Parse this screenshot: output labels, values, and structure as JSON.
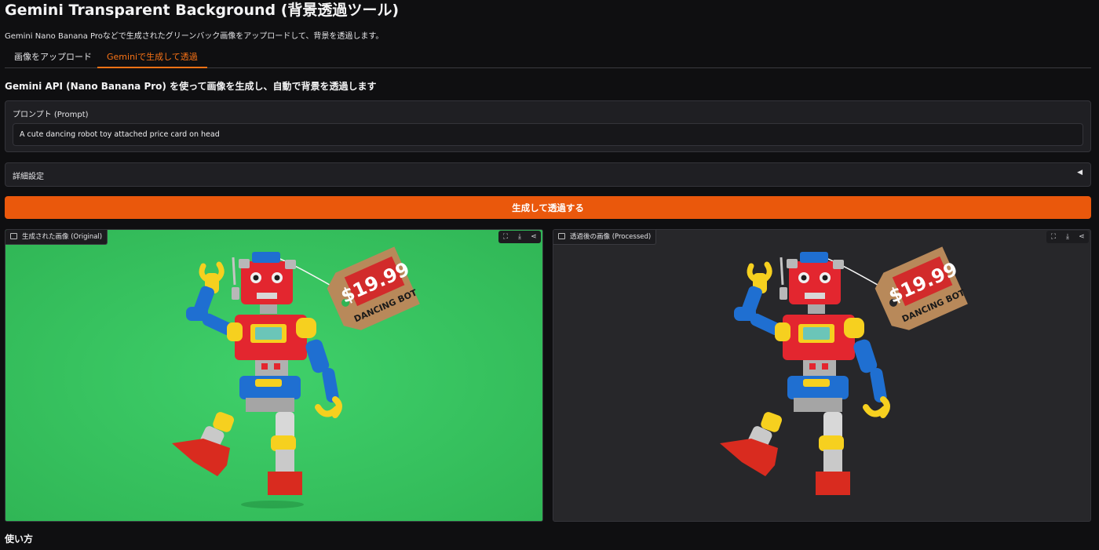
{
  "header": {
    "title": "Gemini Transparent Background (背景透過ツール)",
    "subtitle": "Gemini Nano Banana Proなどで生成されたグリーンバック画像をアップロードして、背景を透過します。"
  },
  "tabs": [
    {
      "label": "画像をアップロード",
      "active": false
    },
    {
      "label": "Geminiで生成して透過",
      "active": true
    }
  ],
  "main": {
    "heading": "Gemini API (Nano Banana Pro) を使って画像を生成し、自動で背景を透過します",
    "prompt_label": "プロンプト (Prompt)",
    "prompt_value": "A cute dancing robot toy attached price card on head",
    "advanced_label": "詳細設定",
    "generate_button": "生成して透過する",
    "usage_heading": "使い方"
  },
  "images": {
    "original_label": "生成された画像 (Original)",
    "processed_label": "透過後の画像 (Processed)",
    "price_tag_price": "$19.99",
    "price_tag_text": "DANCING BOT"
  },
  "colors": {
    "accent": "#f97316",
    "button": "#ea580c",
    "green_screen": "#34c759"
  }
}
